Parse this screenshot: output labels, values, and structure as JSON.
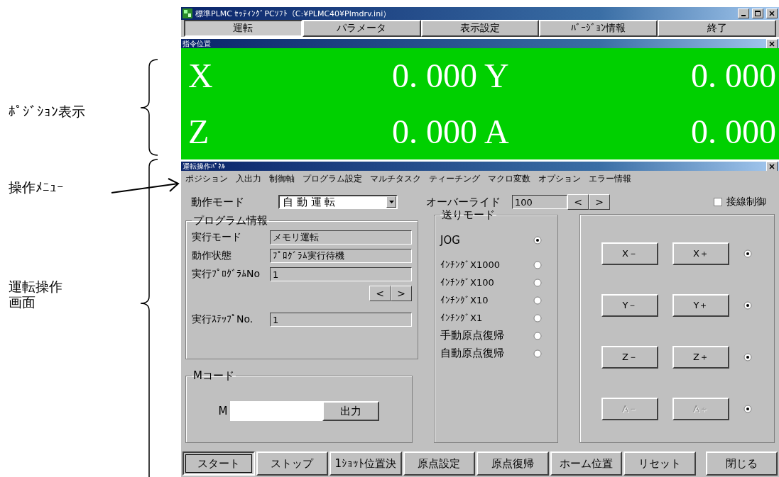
{
  "annotations": [
    {
      "kind": "brace",
      "label": "ﾎﾟｼﾞｼｮﾝ表示"
    },
    {
      "kind": "arrow",
      "label": "操作ﾒﾆｭｰ"
    },
    {
      "kind": "brace",
      "label": "運転操作画面"
    }
  ],
  "window": {
    "title": "標準PLMC ｾｯﾃｨﾝｸﾞPCｿﾌﾄ（C:¥PLMC40¥Plmdrv.ini）"
  },
  "top_tabs": [
    {
      "label": "運転",
      "selected": true
    },
    {
      "label": "パラメータ",
      "selected": false
    },
    {
      "label": "表示設定",
      "selected": false
    },
    {
      "label": "ﾊﾞｰｼﾞｮﾝ情報",
      "selected": false
    },
    {
      "label": "終了",
      "selected": false
    }
  ],
  "position_panel": {
    "title": "指令位置",
    "rows": [
      [
        {
          "axis": "X",
          "value": "0. 000"
        },
        {
          "axis": "Y",
          "value": "0. 000"
        }
      ],
      [
        {
          "axis": "Z",
          "value": "0. 000"
        },
        {
          "axis": "A",
          "value": "0. 000"
        }
      ]
    ]
  },
  "operation_panel": {
    "title": "運転操作ﾊﾟﾈﾙ",
    "menu": [
      "ポジション",
      "入出力",
      "制御軸",
      "プログラム設定",
      "マルチタスク",
      "ティーチング",
      "マクロ変数",
      "オプション",
      "エラー情報"
    ],
    "mode_label": "動作モード",
    "mode_value": "自 動 運 転",
    "override_label": "オーバーライド",
    "override_value": "100",
    "override_prev": "<",
    "override_next": ">",
    "tangent": {
      "label": "接線制御",
      "checked": false
    },
    "program_info": {
      "title": "プログラム情報",
      "fields": [
        {
          "label": "実行モード",
          "value": "メモリ運転"
        },
        {
          "label": "動作状態",
          "value": "ﾌﾟﾛｸﾞﾗﾑ実行待機"
        },
        {
          "label": "実行ﾌﾟﾛｸﾞﾗﾑNo",
          "value": "1"
        },
        {
          "label": "実行ｽﾃｯﾌﾟNo.",
          "value": "1"
        }
      ],
      "prev": "<",
      "next": ">"
    },
    "mcode": {
      "title": "Mコード",
      "prefix": "M",
      "button": "出力"
    },
    "feed_mode": {
      "title": "送りモード",
      "options": [
        {
          "label": "JOG",
          "selected": true
        },
        {
          "label": "ｲﾝﾁﾝｸﾞX1000",
          "selected": false
        },
        {
          "label": "ｲﾝﾁﾝｸﾞX100",
          "selected": false
        },
        {
          "label": "ｲﾝﾁﾝｸﾞX10",
          "selected": false
        },
        {
          "label": "ｲﾝﾁﾝｸﾞX1",
          "selected": false
        },
        {
          "label": "手動原点復帰",
          "selected": false
        },
        {
          "label": "自動原点復帰",
          "selected": false
        }
      ]
    },
    "axis_buttons": [
      {
        "minus": "X－",
        "plus": "X＋",
        "selected": true,
        "disabled": false
      },
      {
        "minus": "Y－",
        "plus": "Y＋",
        "selected": true,
        "disabled": false
      },
      {
        "minus": "Z－",
        "plus": "Z＋",
        "selected": true,
        "disabled": false
      },
      {
        "minus": "A－",
        "plus": "A＋",
        "selected": true,
        "disabled": true
      }
    ],
    "bottom_buttons": [
      {
        "label": "スタート",
        "selected": true
      },
      {
        "label": "ストップ",
        "selected": false
      },
      {
        "label": "1ｼｮｯﾄ位置決",
        "selected": false
      },
      {
        "label": "原点設定",
        "selected": false
      },
      {
        "label": "原点復帰",
        "selected": false
      },
      {
        "label": "ホーム位置",
        "selected": false
      },
      {
        "label": "リセット",
        "selected": false
      },
      {
        "label": "閉じる",
        "selected": false
      }
    ]
  }
}
